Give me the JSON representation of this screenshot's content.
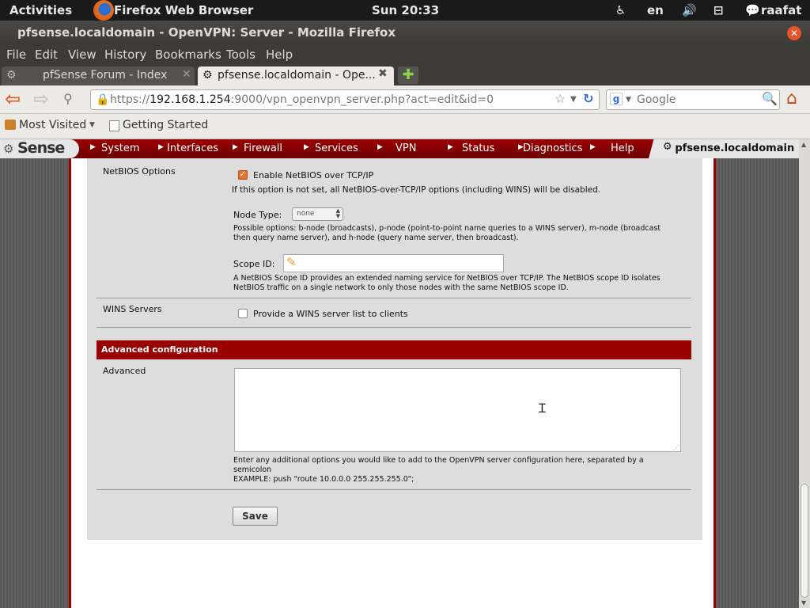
{
  "system_bar": {
    "activities": "Activities",
    "app_name": "Firefox Web Browser",
    "clock": "Sun 20:33",
    "lang": "en",
    "user": "raafat"
  },
  "window": {
    "title": "pfsense.localdomain - OpenVPN: Server - Mozilla Firefox"
  },
  "menu": [
    "File",
    "Edit",
    "View",
    "History",
    "Bookmarks",
    "Tools",
    "Help"
  ],
  "tabs": [
    {
      "label": "pfSense Forum - Index"
    },
    {
      "label": "pfsense.localdomain - Ope..."
    }
  ],
  "url": {
    "scheme": "https://",
    "host": "192.168.1.254",
    "rest": ":9000/vpn_openvpn_server.php?act=edit&id=0"
  },
  "search": {
    "placeholder": "Google"
  },
  "bookmarks": {
    "most_visited": "Most Visited",
    "getting_started": "Getting Started"
  },
  "pfsense_nav": {
    "logo": "Sense",
    "items": [
      "System",
      "Interfaces",
      "Firewall",
      "Services",
      "VPN",
      "Status",
      "Diagnostics",
      "Help"
    ],
    "host": "pfsense.localdomain"
  },
  "form": {
    "netbios": {
      "label": "NetBIOS Options",
      "enable_label": "Enable NetBIOS over TCP/IP",
      "note": "If this option is not set, all NetBIOS-over-TCP/IP options (including WINS) will be disabled.",
      "node_type_label": "Node Type:",
      "node_type_value": "none",
      "node_type_help_1": "Possible options: b-node (broadcasts), p-node (point-to-point name queries to a WINS server), m-node (broadcast",
      "node_type_help_2": "then query name server), and h-node (query name server, then broadcast).",
      "scope_label": "Scope ID:",
      "scope_value": "",
      "scope_help_1": "A NetBIOS Scope ID provides an extended naming service for NetBIOS over TCP/IP. The NetBIOS scope ID isolates",
      "scope_help_2": "NetBIOS traffic on a single network to only those nodes with the same NetBIOS scope ID."
    },
    "wins": {
      "label": "WINS Servers",
      "checkbox_label": "Provide a WINS server list to clients"
    },
    "advanced_header": "Advanced configuration",
    "advanced": {
      "label": "Advanced",
      "value": "",
      "help_1": "Enter any additional options you would like to add to the OpenVPN server configuration here, separated by a",
      "help_2": "semicolon",
      "help_3": "EXAMPLE: push \"route 10.0.0.0 255.255.255.0\";"
    },
    "save_label": "Save"
  },
  "colors": {
    "pf_red": "#990000",
    "panel_bg": "#dddddd",
    "accent_orange": "#e05a1c"
  }
}
